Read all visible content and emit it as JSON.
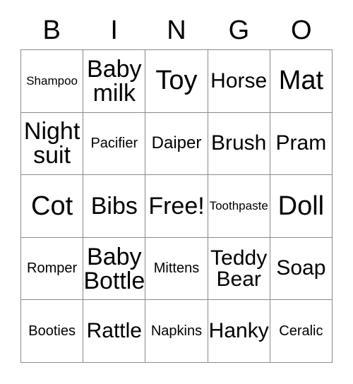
{
  "card": {
    "header_letters": [
      "B",
      "I",
      "N",
      "G",
      "O"
    ],
    "grid_size": 5,
    "free_space_label": "Free!",
    "border_color": "#8a8a8a",
    "background_color": "#ffffff",
    "text_color": "#000000",
    "rows": [
      [
        {
          "label": "Shampoo",
          "size": "s-xxs",
          "lines": 1
        },
        {
          "label": "Baby\nmilk",
          "size": "s-lg",
          "lines": 2
        },
        {
          "label": "Toy",
          "size": "s-xl",
          "lines": 1
        },
        {
          "label": "Horse",
          "size": "s-md",
          "lines": 1
        },
        {
          "label": "Mat",
          "size": "s-xl",
          "lines": 1
        }
      ],
      [
        {
          "label": "Night\nsuit",
          "size": "s-lg",
          "lines": 2
        },
        {
          "label": "Pacifier",
          "size": "s-xs",
          "lines": 1
        },
        {
          "label": "Daiper",
          "size": "s-sm",
          "lines": 1
        },
        {
          "label": "Brush",
          "size": "s-md",
          "lines": 1
        },
        {
          "label": "Pram",
          "size": "s-md",
          "lines": 1
        }
      ],
      [
        {
          "label": "Cot",
          "size": "s-xl",
          "lines": 1
        },
        {
          "label": "Bibs",
          "size": "s-lg",
          "lines": 1
        },
        {
          "label": "Free!",
          "size": "s-lg",
          "lines": 1
        },
        {
          "label": "Toothpaste",
          "size": "s-xxs",
          "lines": 1
        },
        {
          "label": "Doll",
          "size": "s-xl",
          "lines": 1
        }
      ],
      [
        {
          "label": "Romper",
          "size": "s-xs",
          "lines": 1
        },
        {
          "label": "Baby\nBottle",
          "size": "s-lg",
          "lines": 2
        },
        {
          "label": "Mittens",
          "size": "s-xs",
          "lines": 1
        },
        {
          "label": "Teddy\nBear",
          "size": "s-md",
          "lines": 2
        },
        {
          "label": "Soap",
          "size": "s-md",
          "lines": 1
        }
      ],
      [
        {
          "label": "Booties",
          "size": "s-xs",
          "lines": 1
        },
        {
          "label": "Rattle",
          "size": "s-md",
          "lines": 1
        },
        {
          "label": "Napkins",
          "size": "s-xs",
          "lines": 1
        },
        {
          "label": "Hanky",
          "size": "s-md",
          "lines": 1
        },
        {
          "label": "Ceralic",
          "size": "s-xs",
          "lines": 1
        }
      ]
    ]
  }
}
